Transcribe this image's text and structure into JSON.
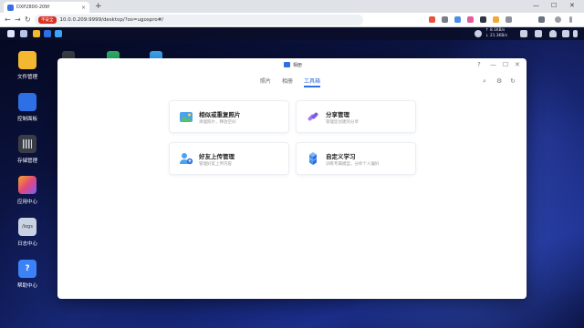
{
  "browser": {
    "tab_title": "DXP2800-209f",
    "tab_close": "×",
    "new_tab": "+",
    "insecure_label": "不安全",
    "url": "10.0.0.209:9999/desktop/?os=ugospro#/",
    "back": "←",
    "forward": "→",
    "reload": "↻",
    "minimize": "—",
    "maximize": "☐",
    "close": "✕",
    "colors": {
      "tabbar": "#dfe3e8",
      "insecure": "#d93025"
    }
  },
  "taskbar": {
    "net_up": "↑ 8.1KB/s",
    "net_down": "↓ 21.3KB/s"
  },
  "desktop": {
    "icons": [
      {
        "label": "文件管理",
        "glyph": "",
        "color": "#f3b730",
        "icon": "folder-icon"
      },
      {
        "label": "控制面板",
        "glyph": "",
        "color": "#2f6fe6",
        "icon": "control-panel-icon"
      },
      {
        "label": "存储管理",
        "glyph": "",
        "color": "#3a3d45",
        "icon": "storage-icon"
      },
      {
        "label": "应用中心",
        "glyph": "",
        "color": "#e2477c",
        "icon": "app-center-icon"
      },
      {
        "label": "日志中心",
        "glyph": "/logs",
        "color": "#c9d2e3",
        "icon": "log-center-icon"
      },
      {
        "label": "帮助中心",
        "glyph": "?",
        "color": "#3b82f6",
        "icon": "help-center-icon"
      }
    ]
  },
  "window": {
    "title": "相册",
    "help": "?",
    "minimize": "—",
    "maximize": "☐",
    "close": "✕",
    "tabs": [
      "照片",
      "相册",
      "工具箱"
    ],
    "active_tab": "工具箱",
    "tools": [
      "search-icon",
      "settings-icon",
      "refresh-icon"
    ],
    "cards": [
      {
        "title": "相似或重复照片",
        "subtitle": "清理照片，释放空间",
        "icon": "landscape-photo-icon"
      },
      {
        "title": "分享管理",
        "subtitle": "管理您创建的分享",
        "icon": "share-link-icon"
      },
      {
        "title": "好友上传管理",
        "subtitle": "管理好友上传内容",
        "icon": "friends-upload-icon"
      },
      {
        "title": "自定义学习",
        "subtitle": "训练专属模型，分析个人偏好",
        "icon": "custom-learning-icon"
      }
    ],
    "colors": {
      "accent": "#2f6fe6"
    }
  }
}
